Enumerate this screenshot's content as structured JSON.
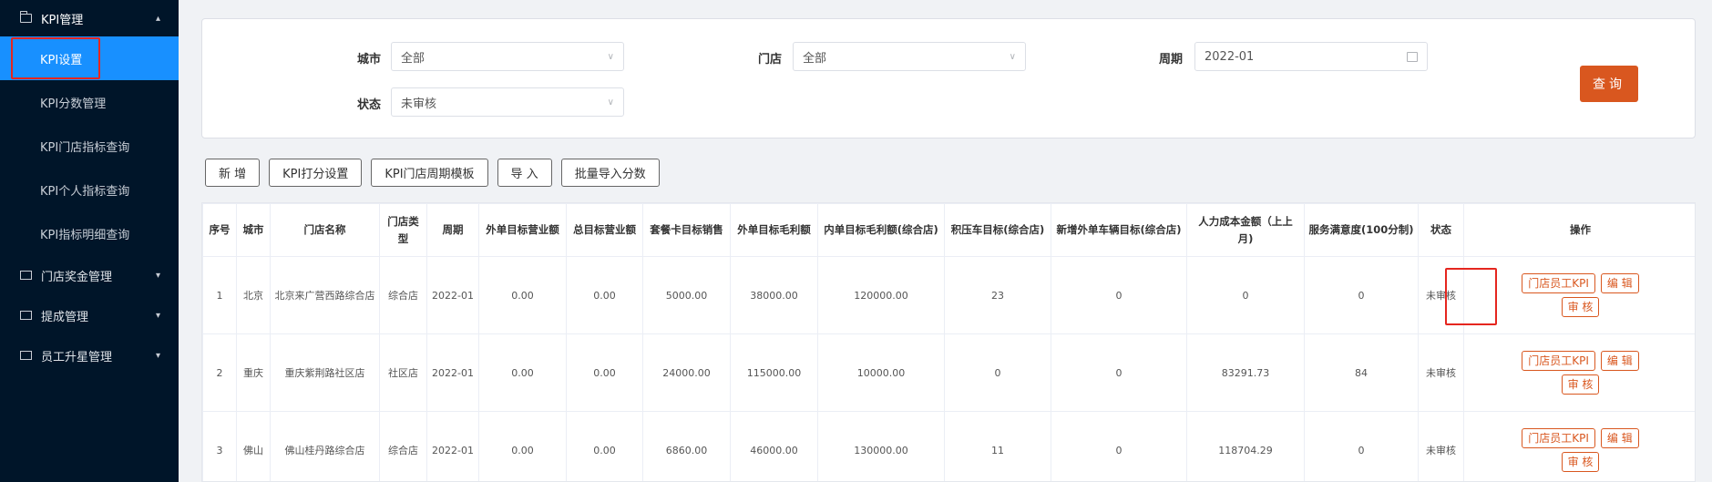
{
  "sidebar": {
    "kpi_group": "KPI管理",
    "kpi_items": [
      "KPI设置",
      "KPI分数管理",
      "KPI门店指标查询",
      "KPI个人指标查询",
      "KPI指标明细查询"
    ],
    "other_groups": [
      "门店奖金管理",
      "提成管理",
      "员工升星管理"
    ]
  },
  "filters": {
    "city_label": "城市",
    "city_value": "全部",
    "store_label": "门店",
    "store_value": "全部",
    "period_label": "周期",
    "period_value": "2022-01",
    "status_label": "状态",
    "status_value": "未审核",
    "query_button": "查询"
  },
  "actions": [
    "新 增",
    "KPI打分设置",
    "KPI门店周期模板",
    "导 入",
    "批量导入分数"
  ],
  "table": {
    "headers": [
      "序号",
      "城市",
      "门店名称",
      "门店类型",
      "周期",
      "外单目标营业额",
      "总目标营业额",
      "套餐卡目标销售",
      "外单目标毛利额",
      "内单目标毛利额(综合店)",
      "积压车目标(综合店)",
      "新增外单车辆目标(综合店)",
      "人力成本金额（上上月)",
      "服务满意度(100分制)",
      "状态",
      "操作"
    ],
    "rows": [
      [
        "1",
        "北京",
        "北京来广营西路综合店",
        "综合店",
        "2022-01",
        "0.00",
        "0.00",
        "5000.00",
        "38000.00",
        "120000.00",
        "23",
        "0",
        "0",
        "0",
        "未审核"
      ],
      [
        "2",
        "重庆",
        "重庆紫荆路社区店",
        "社区店",
        "2022-01",
        "0.00",
        "0.00",
        "24000.00",
        "115000.00",
        "10000.00",
        "0",
        "0",
        "83291.73",
        "84",
        "未审核"
      ],
      [
        "3",
        "佛山",
        "佛山桂丹路综合店",
        "综合店",
        "2022-01",
        "0.00",
        "0.00",
        "6860.00",
        "46000.00",
        "130000.00",
        "11",
        "0",
        "118704.29",
        "0",
        "未审核"
      ]
    ],
    "op_buttons": [
      "门店员工KPI",
      "编 辑",
      "审 核"
    ]
  },
  "colors": {
    "sidebar_bg": "#001529",
    "active_item": "#1890ff",
    "accent": "#d9571f",
    "highlight_box": "#e5261f"
  },
  "icons": [
    "folder-icon",
    "chevron-up-icon",
    "chevron-down-icon",
    "caret-down-icon",
    "calendar-icon"
  ]
}
